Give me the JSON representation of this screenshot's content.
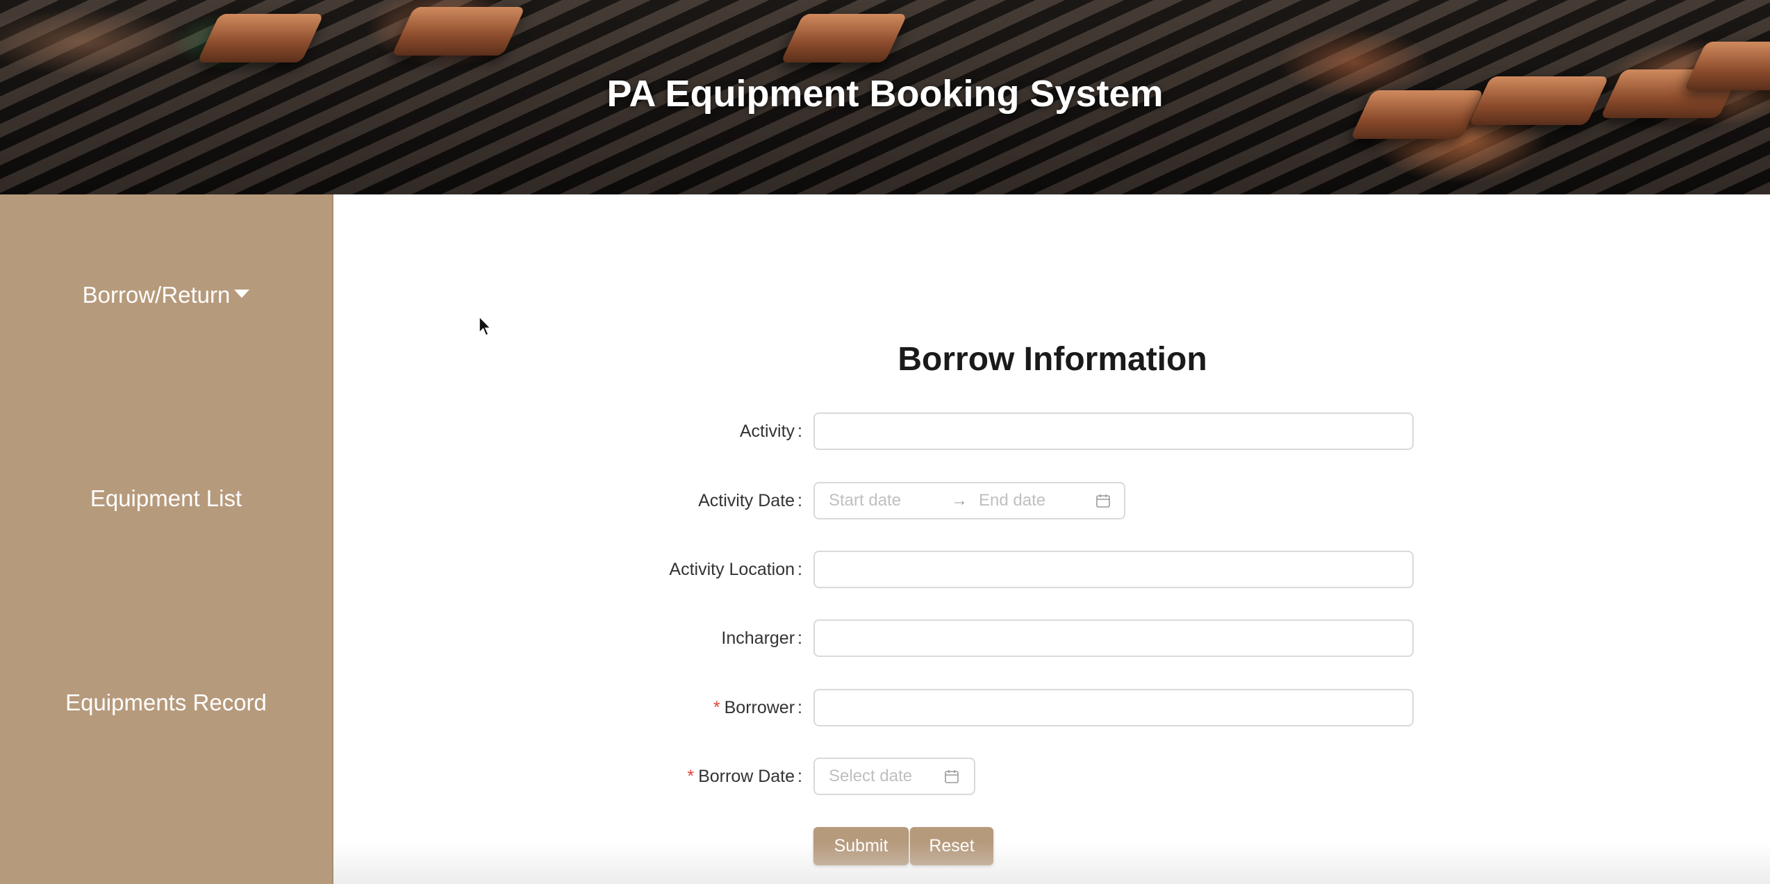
{
  "header": {
    "title": "PA Equipment Booking System"
  },
  "sidebar": {
    "items": [
      {
        "label": "Borrow/Return",
        "has_dropdown": true
      },
      {
        "label": "Equipment List"
      },
      {
        "label": "Equipments Record"
      }
    ],
    "background": "#b69a7c"
  },
  "form": {
    "title": "Borrow Information",
    "activity": {
      "label": "Activity",
      "value": ""
    },
    "activity_date": {
      "label": "Activity Date",
      "start_placeholder": "Start date",
      "separator": "→",
      "end_placeholder": "End date"
    },
    "activity_location": {
      "label": "Activity Location",
      "value": ""
    },
    "incharger": {
      "label": "Incharger",
      "value": ""
    },
    "borrower": {
      "label": "Borrower",
      "required_mark": "*",
      "value": ""
    },
    "borrow_date": {
      "label": "Borrow Date",
      "required_mark": "*",
      "placeholder": "Select date"
    },
    "colon": ":",
    "submit_label": "Submit",
    "reset_label": "Reset"
  },
  "colors": {
    "accent": "#b69a7c",
    "required": "#e0453b",
    "border": "#d9d9d9"
  }
}
